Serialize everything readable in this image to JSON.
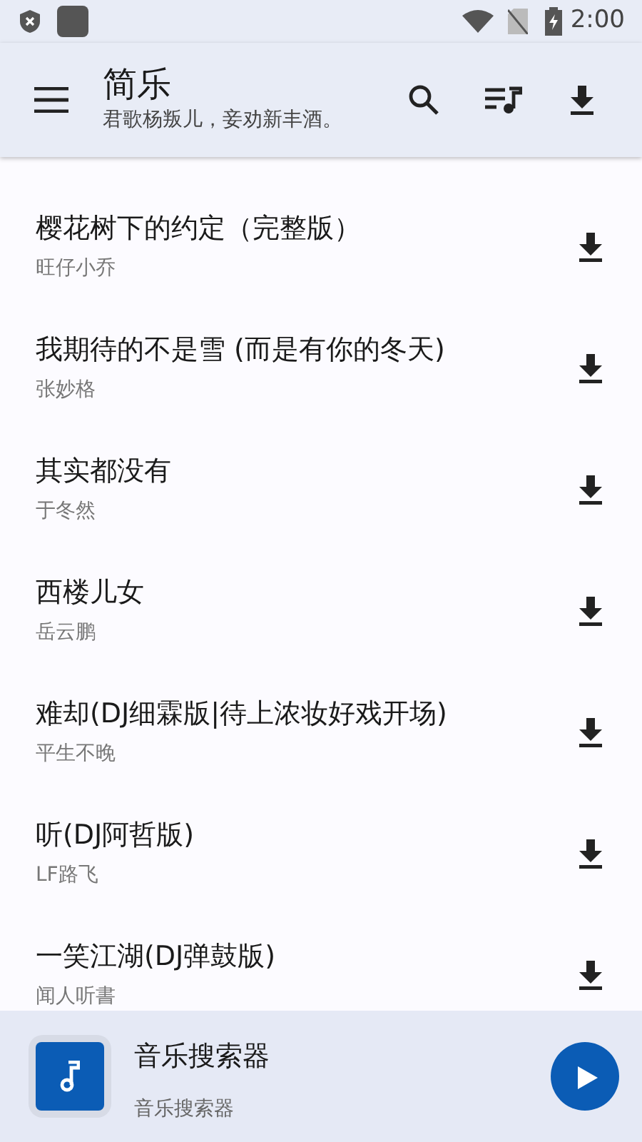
{
  "status_bar": {
    "time": "2:00"
  },
  "app_bar": {
    "title": "简乐",
    "subtitle": "君歌杨叛儿，妾劝新丰酒。"
  },
  "songs": [
    {
      "title": "樱花树下的约定（完整版）",
      "artist": "旺仔小乔"
    },
    {
      "title": "我期待的不是雪 (而是有你的冬天)",
      "artist": "张妙格"
    },
    {
      "title": "其实都没有",
      "artist": "于冬然"
    },
    {
      "title": "西楼儿女",
      "artist": "岳云鹏"
    },
    {
      "title": "难却(DJ细霖版|待上浓妆好戏开场)",
      "artist": "平生不晚"
    },
    {
      "title": "听(DJ阿哲版)",
      "artist": "LF路飞"
    },
    {
      "title": "一笑江湖(DJ弹鼓版)",
      "artist": "闻人听書"
    }
  ],
  "now_playing": {
    "title": "音乐搜索器",
    "subtitle": "音乐搜索器"
  }
}
